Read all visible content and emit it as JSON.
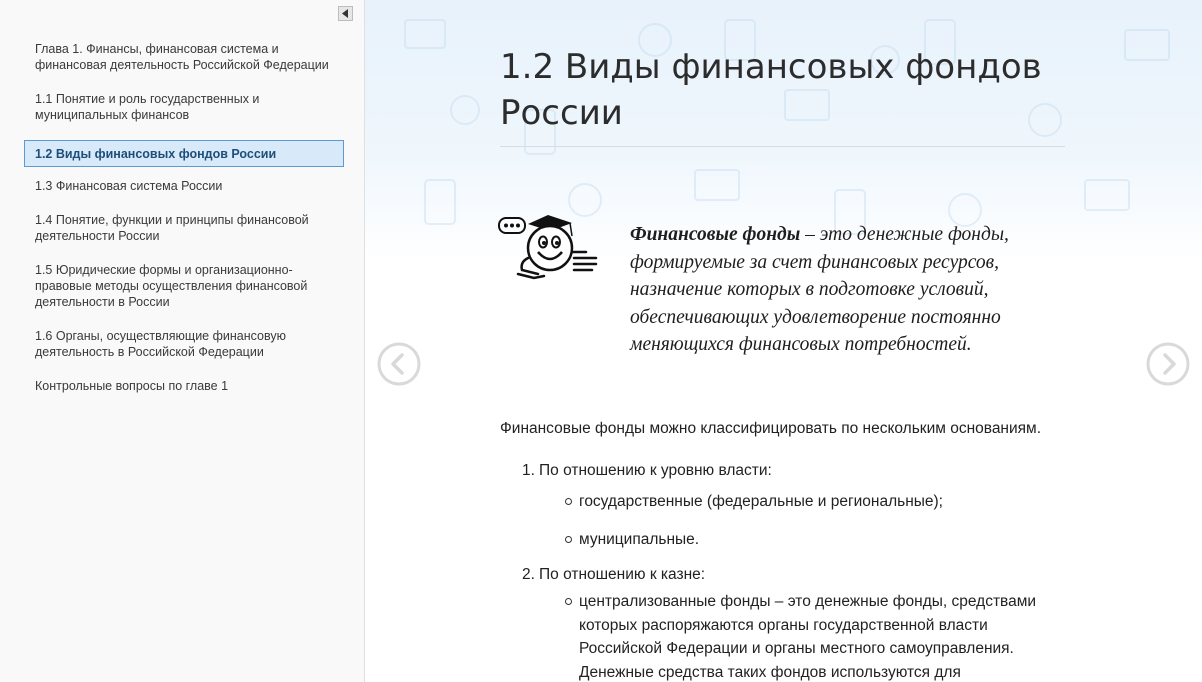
{
  "sidebar": {
    "collapse_icon": "triangle-left-icon",
    "items": [
      {
        "label": "Глава 1. Финансы, финансовая система и финансовая деятельность Российской Федерации",
        "active": false
      },
      {
        "label": "1.1 Понятие и роль государственных и муниципальных финансов",
        "active": false
      },
      {
        "label": "1.2 Виды финансовых фондов России",
        "active": true
      },
      {
        "label": "1.3 Финансовая система России",
        "active": false
      },
      {
        "label": "1.4 Понятие, функции и принципы финансовой деятельности России",
        "active": false
      },
      {
        "label": "1.5 Юридические формы и организационно-правовые методы осуществления финансовой деятельности в России",
        "active": false
      },
      {
        "label": "1.6 Органы, осуществляющие финансовую деятельность в Российской Федерации",
        "active": false
      },
      {
        "label": "Контрольные вопросы по главе 1",
        "active": false
      }
    ]
  },
  "main": {
    "title": "1.2 Виды финансовых фондов России",
    "definition": {
      "term": "Финансовые фонды",
      "text": " – это денежные фонды, формируемые за счет финансовых ресурсов, назначение которых в подготовке условий, обеспечивающих удовлетворение постоянно меняющихся финансовых потребностей."
    },
    "intro": "Финансовые фонды можно классифицировать по нескольким основаниям.",
    "list": [
      {
        "num": "1.",
        "label": "По отношению к уровню власти:",
        "items": [
          "государственные (федеральные и региональные);",
          "муниципальные."
        ]
      },
      {
        "num": "2.",
        "label": "По отношению к казне:",
        "items": [
          "централизованные фонды – это денежные фонды, средствами которых распоряжаются органы государственной власти Российской Федерации и органы местного самоуправления. Денежные средства таких фондов используются для"
        ]
      }
    ]
  },
  "icons": {
    "prev": "chevron-left-circle-icon",
    "next": "chevron-right-circle-icon",
    "mascot": "student-mascot-icon"
  },
  "colors": {
    "active_bg": "#d8eaf9",
    "active_border": "#5b9bd5",
    "active_text": "#1d4f7a",
    "header_bg": "#e8f2fb"
  }
}
